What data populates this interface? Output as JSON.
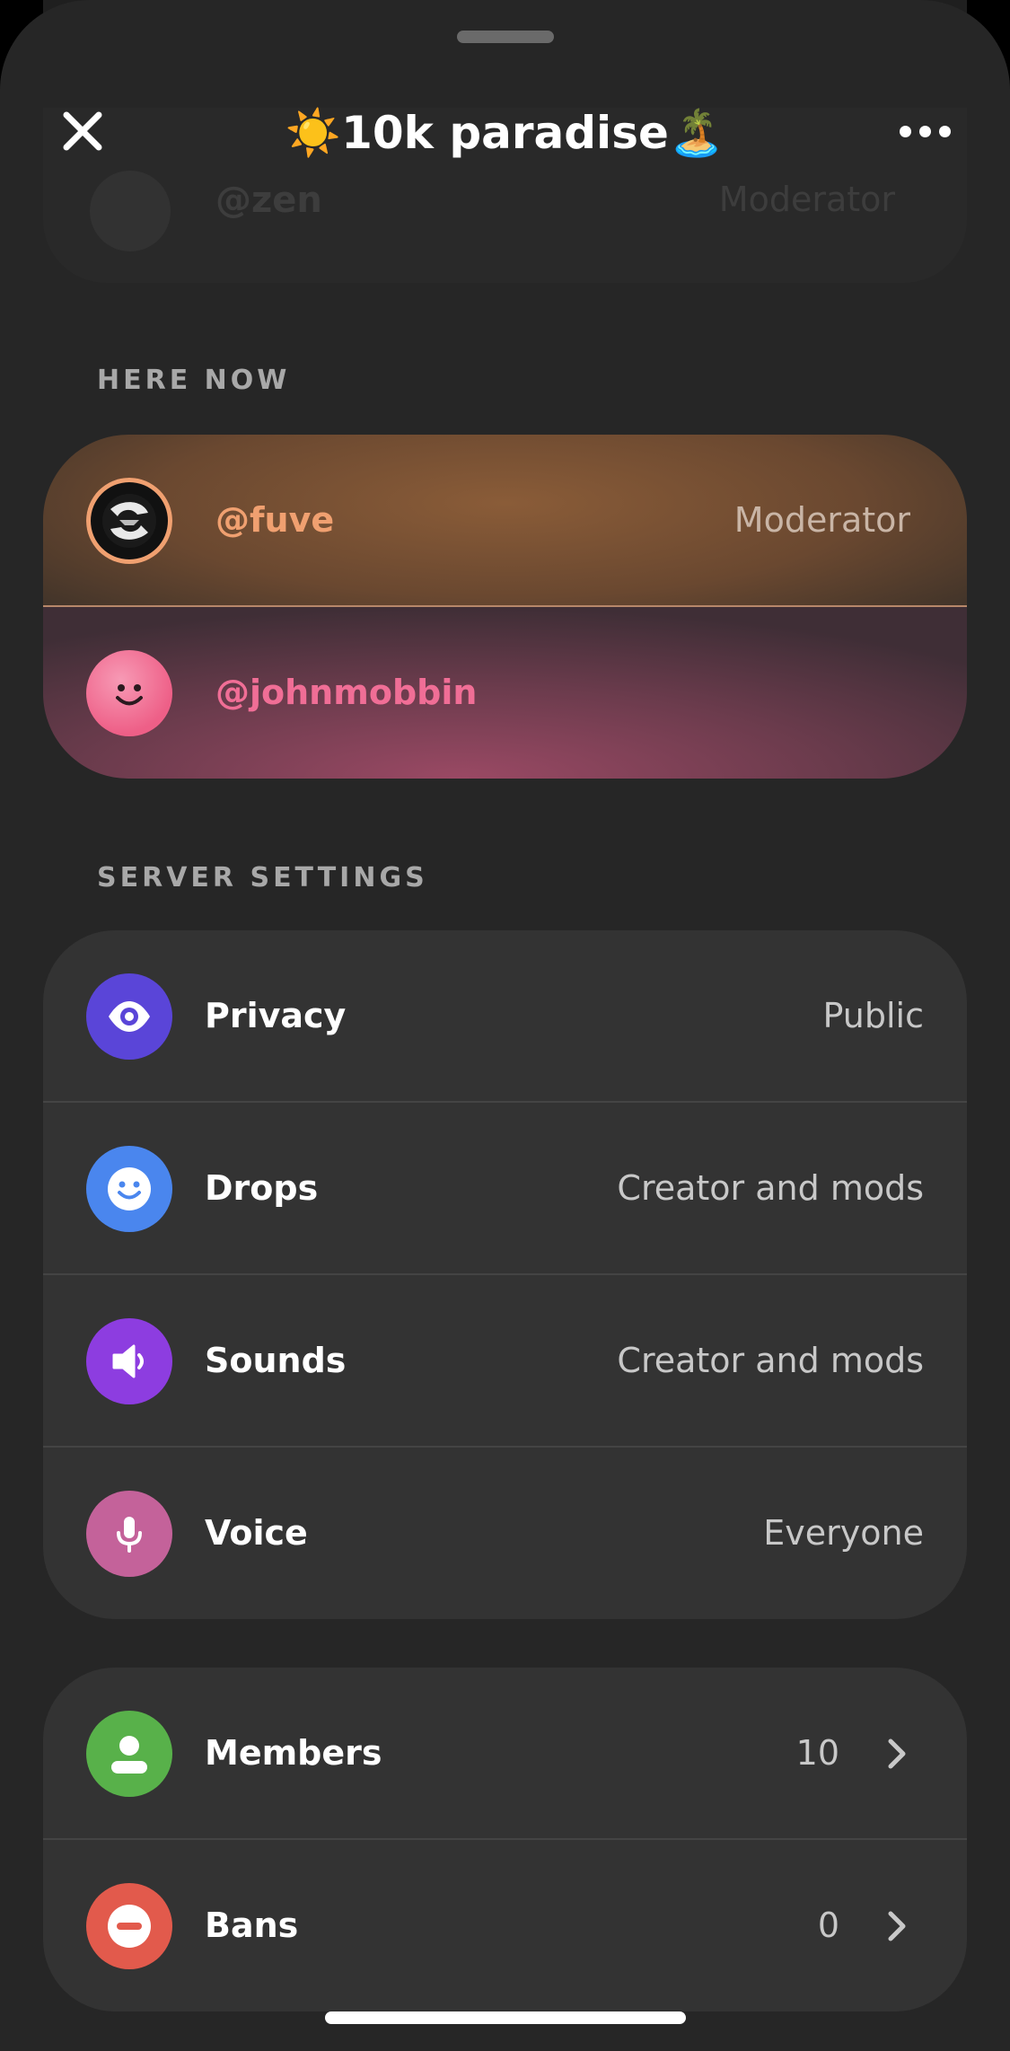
{
  "header": {
    "title": "☀️10k paradise🏝️"
  },
  "ghost_row": {
    "name": "@zen",
    "role": "Moderator"
  },
  "here_now": {
    "label": "HERE NOW",
    "members": [
      {
        "name": "@fuve",
        "role": "Moderator",
        "color": "#f0a070"
      },
      {
        "name": "@johnmobbin",
        "role": "",
        "color": "#f06e96"
      }
    ]
  },
  "server_settings": {
    "label": "SERVER SETTINGS",
    "items": [
      {
        "label": "Privacy",
        "value": "Public",
        "icon": "eye-icon",
        "color": "#5a45d8"
      },
      {
        "label": "Drops",
        "value": "Creator and mods",
        "icon": "smiley-icon",
        "color": "#4a86ee"
      },
      {
        "label": "Sounds",
        "value": "Creator and mods",
        "icon": "speaker-icon",
        "color": "#8d3de0"
      },
      {
        "label": "Voice",
        "value": "Everyone",
        "icon": "microphone-icon",
        "color": "#c4629a"
      }
    ]
  },
  "moderation": {
    "items": [
      {
        "label": "Members",
        "count": "10",
        "icon": "person-icon",
        "color": "#58b14a"
      },
      {
        "label": "Bans",
        "count": "0",
        "icon": "minus-circle-icon",
        "color": "#e25a4c"
      }
    ]
  }
}
